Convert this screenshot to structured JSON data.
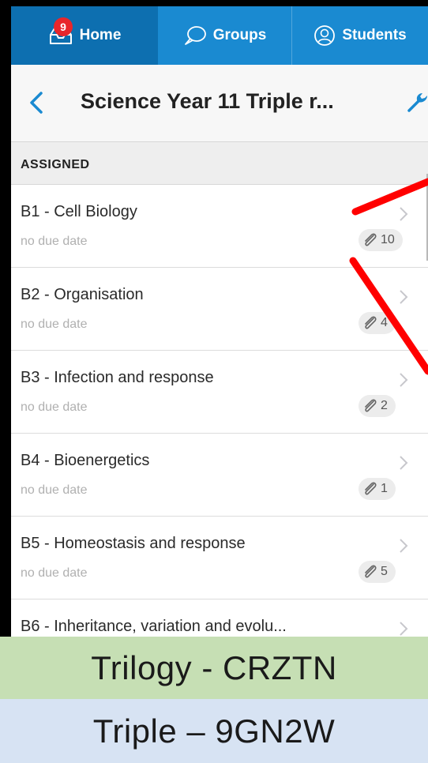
{
  "tabs": {
    "home": {
      "label": "Home",
      "badge": "9",
      "icon": "inbox-icon"
    },
    "groups": {
      "label": "Groups",
      "icon": "chat-bubble-icon"
    },
    "students": {
      "label": "Students",
      "icon": "person-icon"
    }
  },
  "navbar": {
    "title": "Science Year 11 Triple r...",
    "back_icon": "chevron-left-icon",
    "settings_icon": "wrench-icon"
  },
  "section": {
    "label": "ASSIGNED"
  },
  "rows": [
    {
      "title": "B1 - Cell Biology",
      "due": "no due date",
      "attachments": "10"
    },
    {
      "title": "B2 - Organisation",
      "due": "no due date",
      "attachments": "4"
    },
    {
      "title": "B3 - Infection and response",
      "due": "no due date",
      "attachments": "2"
    },
    {
      "title": "B4 - Bioenergetics",
      "due": "no due date",
      "attachments": "1"
    },
    {
      "title": "B5 - Homeostasis and response",
      "due": "no due date",
      "attachments": "5"
    },
    {
      "title": "B6 - Inheritance, variation and evolu...",
      "due": "",
      "attachments": ""
    }
  ],
  "banners": {
    "trilogy": "Trilogy - CRZTN",
    "triple": "Triple – 9GN2W"
  },
  "colors": {
    "tab_blue": "#1a8ad1",
    "tab_active": "#0d6fb0",
    "badge_red": "#e8262b",
    "accent_blue": "#1a8ad1",
    "banner_green": "#c6dfb4",
    "banner_blue": "#d7e3f3",
    "annotation_red": "#ff0000"
  }
}
